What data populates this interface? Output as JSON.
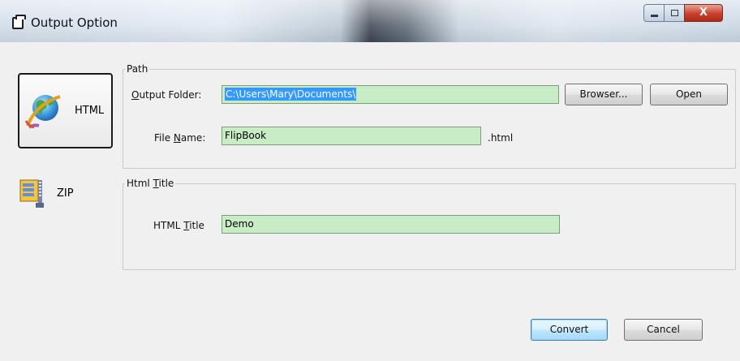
{
  "window": {
    "title": "Output Option",
    "close_glyph": "X"
  },
  "sidebar": {
    "items": [
      {
        "label": "HTML",
        "icon": "globe-icon",
        "selected": true
      },
      {
        "label": "ZIP",
        "icon": "zip-archive-icon",
        "selected": false
      }
    ]
  },
  "path_group": {
    "legend": "Path",
    "output_folder": {
      "label_pre": "",
      "label_key": "O",
      "label_post": "utput Folder:",
      "value": "C:\\Users\\Mary\\Documents\\"
    },
    "browser_button": "Browser...",
    "open_button": "Open",
    "file_name": {
      "label_pre": "File ",
      "label_key": "N",
      "label_post": "ame:",
      "value": "FlipBook",
      "extension": ".html"
    }
  },
  "html_title_group": {
    "legend_pre": "Html ",
    "legend_key": "T",
    "legend_post": "itle",
    "label_pre": "HTML ",
    "label_key": "T",
    "label_post": "itle",
    "value": "Demo"
  },
  "footer": {
    "convert_button": "Convert",
    "cancel_button": "Cancel"
  },
  "colors": {
    "field_bg": "#c8edc5",
    "selection": "#3399ff",
    "close_button": "#c8402c"
  }
}
